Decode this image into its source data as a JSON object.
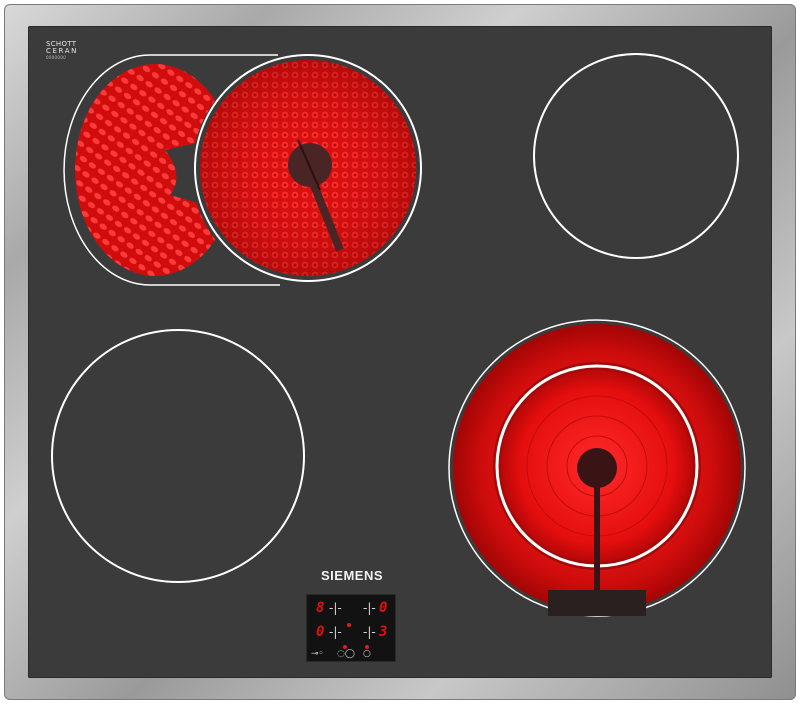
{
  "logos": {
    "schott_line1": "SCHOTT",
    "schott_line2": "CERAN",
    "schott_code": "0000000"
  },
  "brand": "SIEMENS",
  "display": {
    "front_left_level": "8",
    "rear_right_level": "0",
    "rear_left_level": "0",
    "front_right_level": "3"
  },
  "colors": {
    "glass": "#3b3b3b",
    "heating_red": "#e81010",
    "zone_outline": "#ffffff",
    "frame_steel": "#a9a9a9"
  },
  "zones": [
    {
      "name": "rear-left",
      "state": "on",
      "type": "extended oval"
    },
    {
      "name": "rear-right",
      "state": "off"
    },
    {
      "name": "front-left",
      "state": "off"
    },
    {
      "name": "front-right",
      "state": "on",
      "type": "dual ring"
    }
  ]
}
